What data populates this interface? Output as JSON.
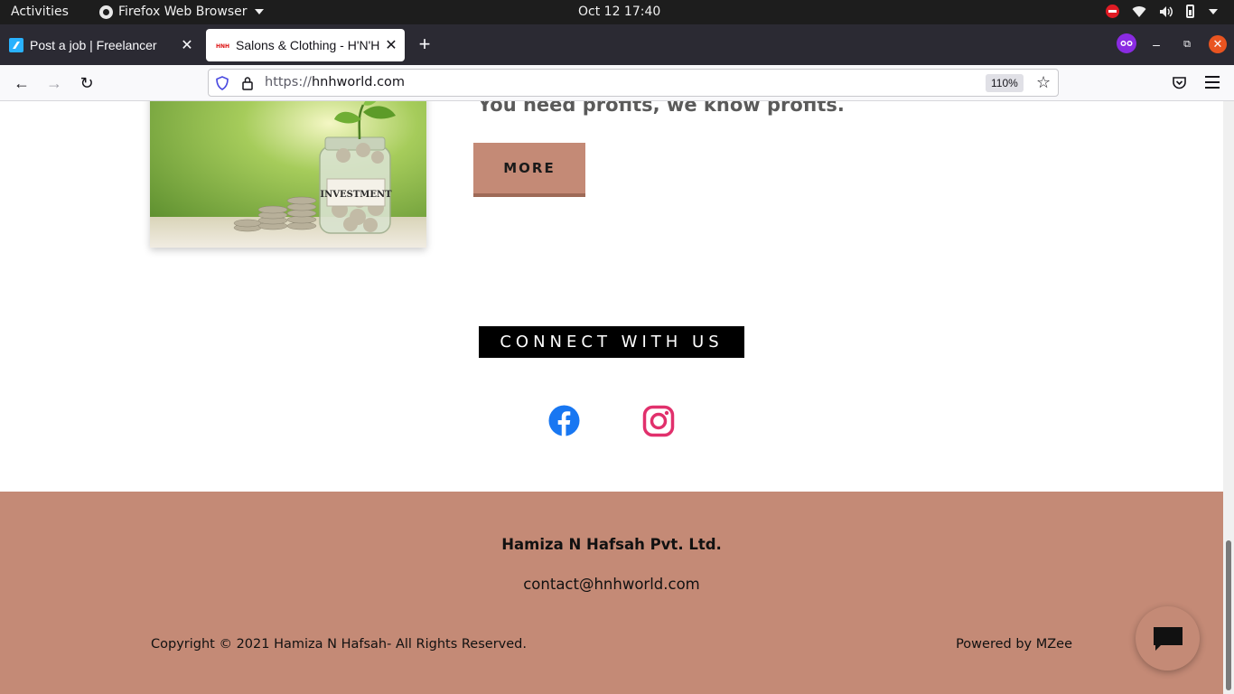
{
  "system_bar": {
    "activities": "Activities",
    "app_name": "Firefox Web Browser",
    "clock": "Oct 12  17:40"
  },
  "tabs": [
    {
      "label": "Post a job | Freelancer",
      "icon": "freelancer-favicon",
      "active": false
    },
    {
      "label": "Salons & Clothing - H'N'H",
      "icon": "hnh-favicon",
      "active": true
    }
  ],
  "navbar": {
    "url_protocol": "https://",
    "url_host": "hnhworld.com",
    "zoom": "110%"
  },
  "content": {
    "tagline": "You need profits, we know profits.",
    "more_button": "MORE",
    "image_label": "INVESTMENT",
    "connect_heading": "CONNECT WITH US"
  },
  "footer": {
    "company": "Hamiza N Hafsah Pvt. Ltd.",
    "email": "contact@hnhworld.com",
    "copyright": "Copyright © 2021 Hamiza N Hafsah- All Rights Reserved.",
    "powered_by": "Powered by MZee"
  },
  "colors": {
    "brand_accent": "#c48a76",
    "facebook": "#1877f2",
    "instagram": "#e1306c"
  }
}
